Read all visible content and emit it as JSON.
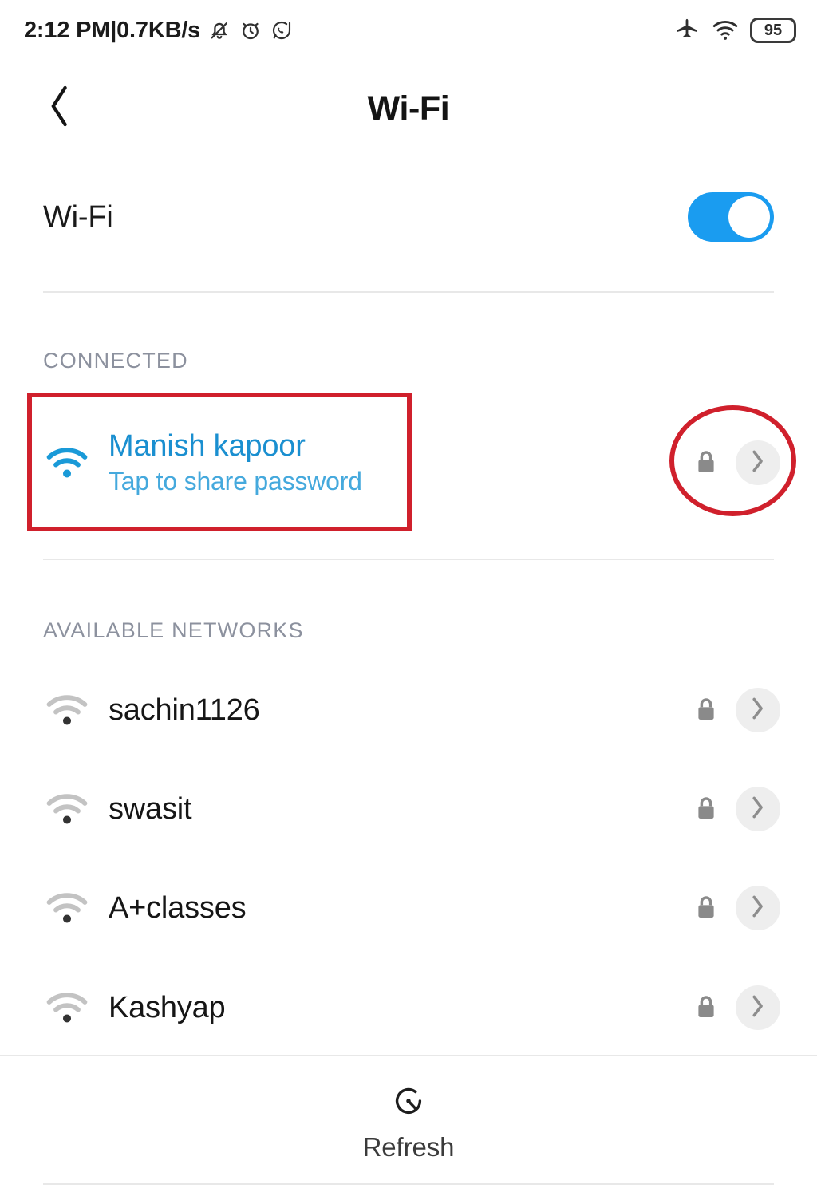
{
  "status_bar": {
    "time": "2:12 PM",
    "separator": "|",
    "network_speed": "0.7KB/s",
    "left_icons": [
      "mute-bell-icon",
      "alarm-clock-icon",
      "whatsapp-icon"
    ],
    "right_icons": [
      "airplane-mode-icon",
      "wifi-signal-icon"
    ],
    "battery_level": "95"
  },
  "header": {
    "back_icon": "chevron-left-icon",
    "title": "Wi-Fi"
  },
  "wifi_master": {
    "label": "Wi-Fi",
    "toggle_state": "on",
    "toggle_color": "#1a9cf0"
  },
  "sections": {
    "connected": {
      "header": "CONNECTED",
      "network": {
        "name": "Manish kapoor",
        "subtitle": "Tap to share password",
        "wifi_icon": "wifi-signal-icon",
        "lock_icon": "lock-icon",
        "chevron_icon": "chevron-right-icon",
        "accent_color": "#1a8fd0"
      }
    },
    "available": {
      "header": "AVAILABLE NETWORKS",
      "networks": [
        {
          "name": "sachin1126",
          "wifi_icon": "wifi-signal-icon",
          "lock_icon": "lock-icon",
          "chevron_icon": "chevron-right-icon"
        },
        {
          "name": "swasit",
          "wifi_icon": "wifi-signal-icon",
          "lock_icon": "lock-icon",
          "chevron_icon": "chevron-right-icon"
        },
        {
          "name": "A+classes",
          "wifi_icon": "wifi-signal-icon",
          "lock_icon": "lock-icon",
          "chevron_icon": "chevron-right-icon"
        },
        {
          "name": "Kashyap",
          "wifi_icon": "wifi-signal-icon",
          "lock_icon": "lock-icon",
          "chevron_icon": "chevron-right-icon"
        }
      ]
    }
  },
  "footer": {
    "refresh_label": "Refresh",
    "refresh_icon": "refresh-clock-icon"
  },
  "annotations": {
    "color": "#d0202c",
    "rectangle_target": "connected-network-row",
    "ellipse_target": "connected-network-actions"
  }
}
